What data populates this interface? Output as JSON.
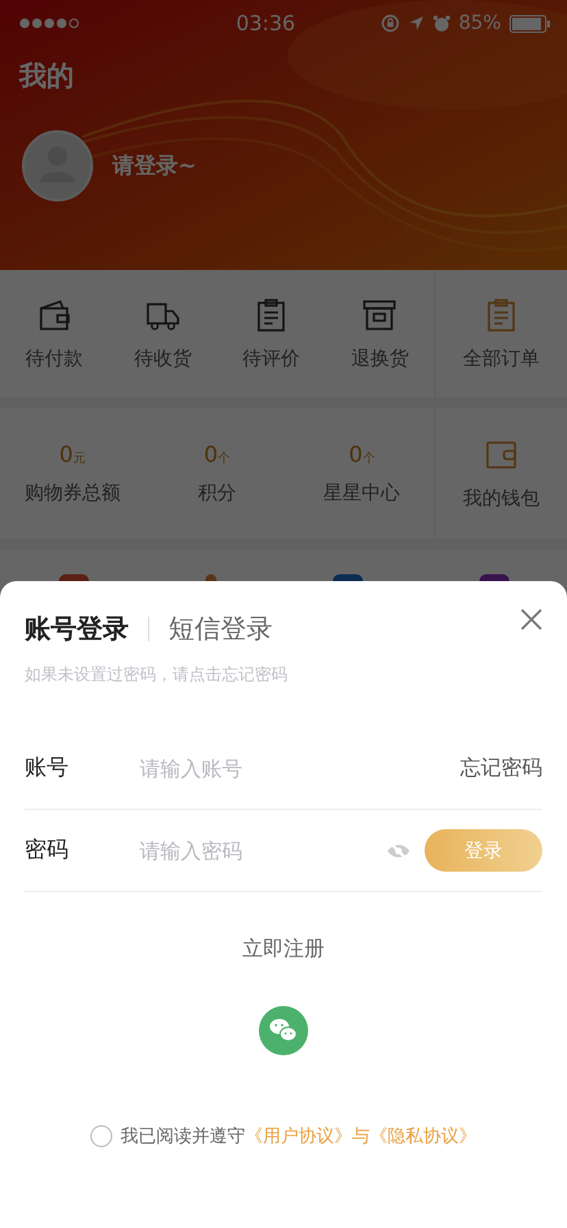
{
  "status_bar": {
    "time": "03:36",
    "battery": "85%"
  },
  "header": {
    "title": "我的",
    "login_prompt": "请登录~"
  },
  "orders": [
    {
      "label": "待付款",
      "kind": "wallet"
    },
    {
      "label": "待收货",
      "kind": "truck"
    },
    {
      "label": "待评价",
      "kind": "clipboard"
    },
    {
      "label": "退换货",
      "kind": "box"
    },
    {
      "label": "全部订单",
      "kind": "clipboard-all"
    }
  ],
  "assets": [
    {
      "value": "0",
      "unit": "元",
      "label": "购物券总额"
    },
    {
      "value": "0",
      "unit": "个",
      "label": "积分"
    },
    {
      "value": "0",
      "unit": "个",
      "label": "星星中心"
    }
  ],
  "wallet": {
    "label": "我的钱包"
  },
  "login_sheet": {
    "tabs": [
      {
        "label": "账号登录",
        "selected": true
      },
      {
        "label": "短信登录",
        "selected": false
      }
    ],
    "hint": "如果未设置过密码，请点击忘记密码",
    "account": {
      "label": "账号",
      "placeholder": "请输入账号",
      "forgot": "忘记密码"
    },
    "password": {
      "label": "密码",
      "placeholder": "请输入密码",
      "visible": false,
      "submit": "登录"
    },
    "register": "立即注册",
    "agreement": {
      "checked": false,
      "prefix": "我已阅读并遵守",
      "link_1": "《用户协议》",
      "joiner": "与",
      "link_2": "《隐私协议》"
    }
  }
}
